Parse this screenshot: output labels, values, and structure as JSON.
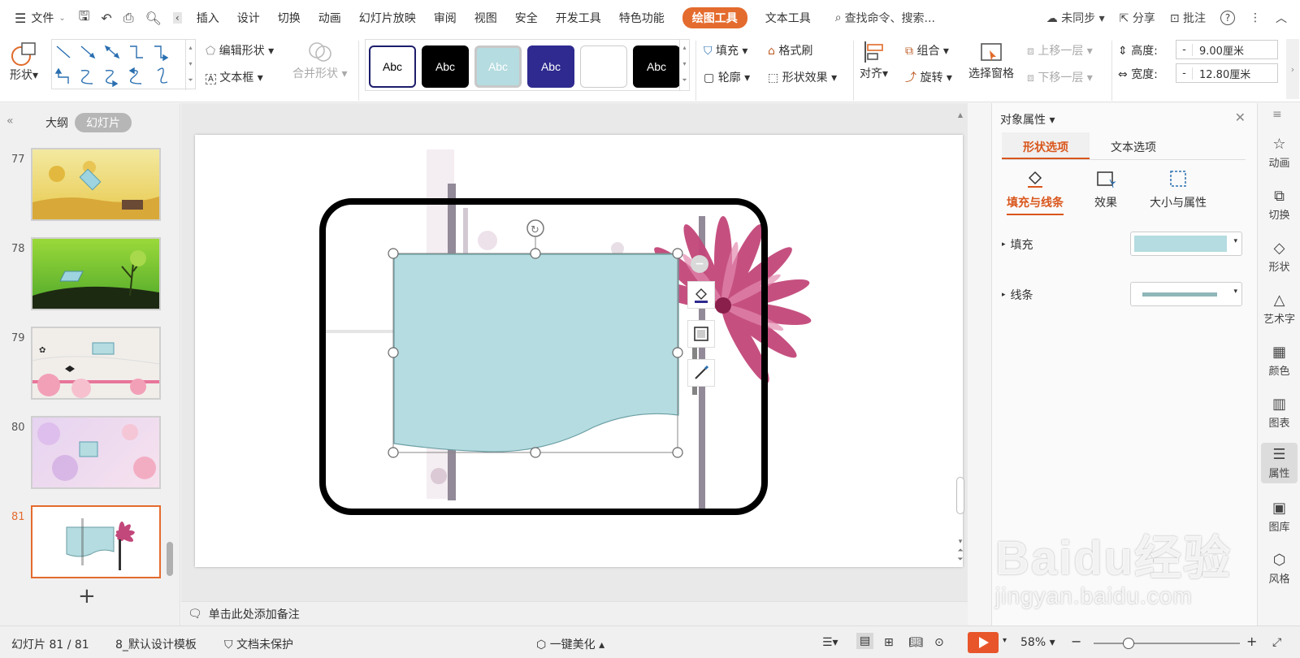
{
  "menu": {
    "file": "文件",
    "tabs": [
      "插入",
      "设计",
      "切换",
      "动画",
      "幻灯片放映",
      "审阅",
      "视图",
      "安全",
      "开发工具",
      "特色功能"
    ],
    "active_tab": "绘图工具",
    "text_tools": "文本工具",
    "search": "查找命令、搜索...",
    "sync": "未同步",
    "share": "分享",
    "review": "批注"
  },
  "ribbon": {
    "shape": "形状",
    "edit_shape": "编辑形状",
    "text_box": "文本框",
    "merge_shape": "合并形状",
    "style_label": "Abc",
    "fill": "填充",
    "format_brush": "格式刷",
    "outline": "轮廓",
    "shape_effect": "形状效果",
    "align": "对齐",
    "group": "组合",
    "rotate": "旋转",
    "selection_pane": "选择窗格",
    "bring_forward": "上移一层",
    "send_backward": "下移一层",
    "height_label": "高度:",
    "height_value": "9.00厘米",
    "width_label": "宽度:",
    "width_value": "12.80厘米",
    "minus": "-"
  },
  "left_panel": {
    "outline_tab": "大纲",
    "slides_tab": "幻灯片",
    "slides": [
      {
        "num": "77"
      },
      {
        "num": "78"
      },
      {
        "num": "79"
      },
      {
        "num": "80"
      },
      {
        "num": "81"
      }
    ],
    "add": "+"
  },
  "notes_placeholder": "单击此处添加备注",
  "property_panel": {
    "title": "对象属性",
    "tab_shape": "形状选项",
    "tab_text": "文本选项",
    "sub_fill_line": "填充与线条",
    "sub_effect": "效果",
    "sub_size": "大小与属性",
    "fill_label": "填充",
    "line_label": "线条",
    "fill_color": "#b5dce0",
    "line_color": "#8fb6b9"
  },
  "right_strip": [
    "动画",
    "切换",
    "形状",
    "艺术字",
    "颜色",
    "图表",
    "属性",
    "图库",
    "风格"
  ],
  "status": {
    "slide_counter": "幻灯片 81 / 81",
    "template": "8_默认设计模板",
    "protect": "文档未保护",
    "beautify": "一键美化",
    "zoom": "58%"
  },
  "watermark": {
    "brand": "Baidu经验",
    "url": "jingyan.baidu.com"
  },
  "colors": {
    "accent": "#e46b2e",
    "shape_fill": "#b5dce0",
    "petal": "#c2477a"
  }
}
